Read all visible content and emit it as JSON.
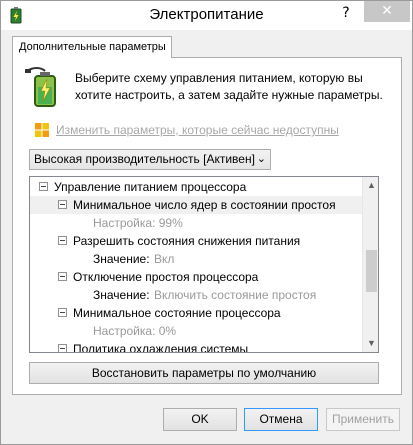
{
  "window": {
    "title": "Электропитание",
    "help_glyph": "?",
    "close_glyph": "✕",
    "icons": {
      "app": "power-options-icon",
      "help": "help-icon",
      "close": "close-icon"
    }
  },
  "tab": {
    "label": "Дополнительные параметры"
  },
  "intro": {
    "text": "Выберите схему управления питанием, которую вы хотите настроить, а затем задайте нужные параметры.",
    "icon": "battery-power-icon"
  },
  "change_link": {
    "label": "Изменить параметры, которые сейчас недоступны",
    "icon": "shield-icon"
  },
  "plan_select": {
    "value": "Высокая производительность [Активен]",
    "chevron": "⌄"
  },
  "tree": {
    "items": [
      {
        "text": "Управление питанием процессора"
      },
      {
        "text": "Минимальное число ядер в состоянии простоя"
      },
      {
        "text": "Настройка: 99%"
      },
      {
        "text": "Разрешить состояния снижения питания"
      },
      {
        "label": "Значение:",
        "value": "Вкл"
      },
      {
        "text": "Отключение простоя процессора"
      },
      {
        "label": "Значение:",
        "value": "Включить состояние простоя"
      },
      {
        "text": "Минимальное состояние процессора"
      },
      {
        "text": "Настройка: 0%"
      },
      {
        "text": "Политика охлаждения системы"
      }
    ],
    "scroll_up": "▲",
    "scroll_down": "▼"
  },
  "buttons": {
    "restore": "Восстановить параметры по умолчанию",
    "ok": "OK",
    "cancel": "Отмена",
    "apply": "Применить"
  },
  "colors": {
    "accent_focus": "#3399ff",
    "disabled_text": "#a0a0a0",
    "window_bg": "#f0f0f0"
  }
}
